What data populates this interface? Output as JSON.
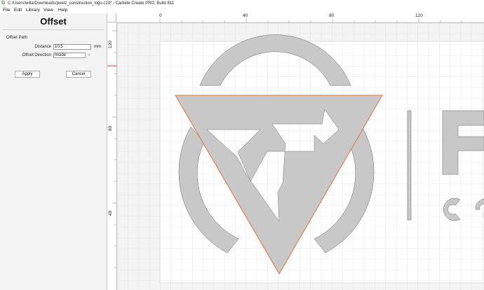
{
  "window": {
    "title": "C:/Users/willa/Downloads/puetz_construction_logo.c2d* - Carbide Create PRO, Build 811",
    "app_icon": "carbide-logo-icon"
  },
  "menu": {
    "items": [
      "File",
      "Edit",
      "Library",
      "View",
      "Help"
    ]
  },
  "panel": {
    "heading": "Offset",
    "section": "Offset Path",
    "distance_label": "Distance",
    "distance_value": "10.5",
    "distance_unit": "mm",
    "direction_label": "Offset Direction",
    "direction_value": "Inside",
    "apply_label": "Apply",
    "cancel_label": "Cancel"
  },
  "ruler": {
    "top_labels": [
      "0",
      "40",
      "80",
      "120"
    ],
    "left_labels": [
      "120",
      "80",
      "40"
    ]
  },
  "colors": {
    "selection": "#e8733a",
    "shape_fill": "#c8c8c8",
    "grid": "#d6d6d6"
  }
}
